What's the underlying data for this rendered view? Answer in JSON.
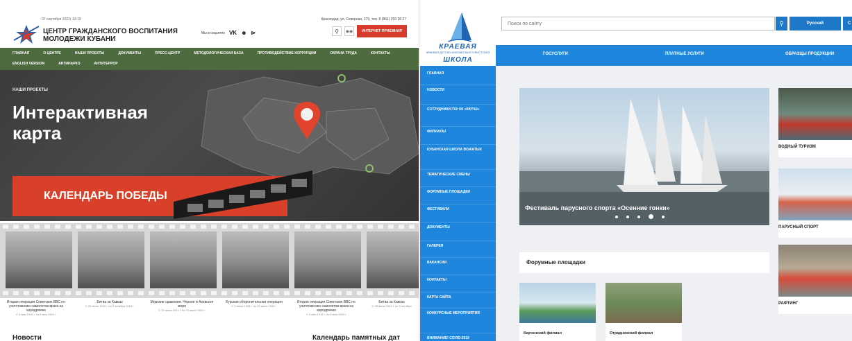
{
  "left": {
    "date": "07 сентября 2022г 12:19",
    "org_title_line1": "ЦЕНТР ГРАЖДАНСКОГО ВОСПИТАНИЯ",
    "org_title_line2": "МОЛОДЕЖИ КУБАНИ",
    "social_label": "Мы в соцсетях",
    "social_icons": [
      "vk-icon",
      "ok-icon",
      "rss-icon"
    ],
    "address": "Краснодар, ул. Северная, 279, тел. 8 (861) 259 28 27",
    "reception_button": "ИНТЕРНЕТ-ПРИЕМНАЯ",
    "nav_items": [
      "ГЛАВНАЯ",
      "О ЦЕНТРЕ",
      "НАШИ ПРОЕКТЫ",
      "ДОКУМЕНТЫ",
      "ПРЕСС-ЦЕНТР",
      "МЕТОДОЛОГИЧЕСКАЯ БАЗА",
      "ПРОТИВОДЕЙСТВИЕ КОРРУПЦИИ",
      "ОХРАНА ТРУДА",
      "КОНТАКТЫ",
      "ENGLISH VERSION",
      "АНТИНАРКО",
      "АНТИТЕРРОР"
    ],
    "breadcrumb": "НАШИ ПРОЕКТЫ",
    "hero_title_line1": "Интерактивная",
    "hero_title_line2": "карта",
    "calendar_banner": "КАЛЕНДАРЬ ПОБЕДЫ",
    "captions": [
      {
        "title": "Вторая операция Советских ВВС по уничтожению самолетов врага на аэродромах",
        "date": "С 6 мая 1943 г. по 8 мая 1943 г."
      },
      {
        "title": "Битва за Кавказ",
        "date": "С 25 июля 1942 г. по 9 октября 1943 г."
      },
      {
        "title": "Морские сражения. Черное и Азовское моря",
        "date": "С 22 июня 1941 г. по 23 июня 1944 г."
      },
      {
        "title": "Курская оборонительная операция",
        "date": "С 5 июля 1943 г. по 23 июля 1943 г."
      },
      {
        "title": "Вторая операция Советских ВВС по уничтожению самолетов врага на аэродромах",
        "date": "С 6 мая 1943 г. по 8 мая 1943 г."
      },
      {
        "title": "Битва за Кавказ",
        "date": "С 25 июля 1942 г. по 9 октября"
      }
    ],
    "news_heading": "Новости",
    "memorable_dates_heading": "Календарь памятных дат",
    "accent_color": "#d63a2a",
    "nav_color": "#4e6b3f"
  },
  "right": {
    "logo_text_line1": "КРАЕВАЯ",
    "logo_text_sub": "КРАЕВАЯ ДЕТСКО-ЮНОШЕСКАЯ ТУРИСТСКАЯ",
    "logo_text_line2": "ШКОЛА",
    "search_placeholder": "Поиск по сайту",
    "language_button": "Русский",
    "language_button2": "С",
    "top_nav": [
      "ГОСУСЛУГИ",
      "ПЛАТНЫЕ УСЛУГИ",
      "ОБРАЗЦЫ ПРОДУКЦИИ"
    ],
    "sidebar": [
      "ГЛАВНАЯ",
      "НОВОСТИ",
      "СОТРУДНИКИ ГБУ КК «КЮТШ»",
      "ФИЛИАЛЫ",
      "КУБАНСКАЯ ШКОЛА ВОЖАТЫХ",
      "ТЕМАТИЧЕСКИЕ СМЕНЫ",
      "ФОРУМНЫЕ ПЛОЩАДКИ",
      "ФЕСТИВАЛИ",
      "ДОКУМЕНТЫ",
      "ГАЛЕРЕЯ",
      "ВАКАНСИИ",
      "КОНТАКТЫ",
      "КАРТА САЙТА",
      "КОНКУРСНЫЕ МЕРОПРИЯТИЯ",
      "ВНИМАНИЕ! COVID-2019"
    ],
    "slider_caption": "Фестиваль парусного спорта «Осенние гонки»",
    "slider_dot_count": 5,
    "slider_active_dot": 4,
    "side_cards": [
      "ВОДНЫЙ ТУРИЗМ",
      "ПАРУСНЫЙ СПОРТ",
      "РАФТИНГ"
    ],
    "forum_heading": "Форумные площадки",
    "branches": [
      "Керченский филиал",
      "Отрадненский филиал"
    ],
    "accent_color": "#1e86dd"
  }
}
